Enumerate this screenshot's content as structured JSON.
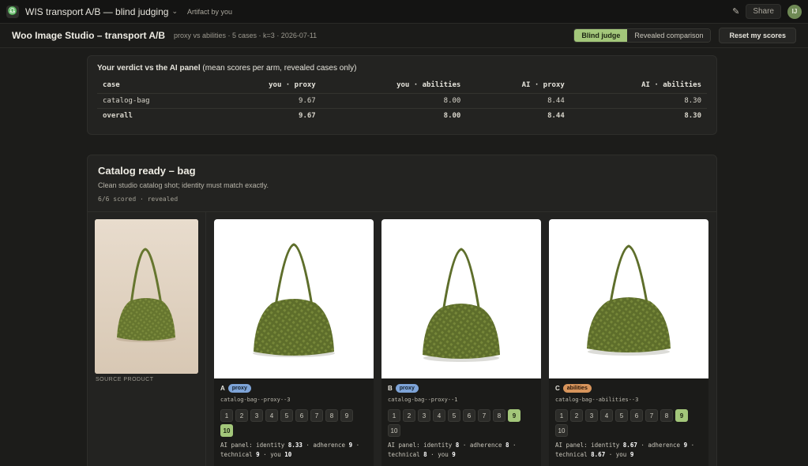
{
  "topbar": {
    "title": "WIS transport A/B — blind judging",
    "artifact": "Artifact by you",
    "share": "Share",
    "avatar": "IJ"
  },
  "header": {
    "title": "Woo Image Studio – transport A/B",
    "meta": "proxy vs abilities · 5 cases · k=3 · 2026-07-11",
    "modes": [
      "Blind judge",
      "Revealed comparison"
    ],
    "active_mode": "Blind judge",
    "reset": "Reset my scores"
  },
  "verdict": {
    "title_bold": "Your verdict vs the AI panel",
    "title_rest": " (mean scores per arm, revealed cases only)",
    "columns": [
      "case",
      "you · proxy",
      "you · abilities",
      "AI · proxy",
      "AI · abilities"
    ],
    "rows": [
      [
        "catalog-bag",
        "9.67",
        "8.00",
        "8.44",
        "8.30"
      ],
      [
        "overall",
        "9.67",
        "8.00",
        "8.44",
        "8.30"
      ]
    ]
  },
  "case": {
    "title": "Catalog ready – bag",
    "desc": "Clean studio catalog shot; identity must match exactly.",
    "status": "6/6 scored · revealed",
    "source_caption": "SOURCE PRODUCT",
    "candidates": [
      {
        "letter": "A",
        "arm": "proxy",
        "slug": "catalog-bag--proxy--3",
        "selected": 10,
        "panel": [
          "AI panel: identity ",
          "8.33",
          " · adherence ",
          "9",
          " · technical ",
          "9",
          " · you ",
          "10"
        ]
      },
      {
        "letter": "B",
        "arm": "proxy",
        "slug": "catalog-bag--proxy--1",
        "selected": 9,
        "panel": [
          "AI panel: identity ",
          "8",
          " · adherence ",
          "8",
          " · technical ",
          "8",
          " · you ",
          "9"
        ]
      },
      {
        "letter": "C",
        "arm": "abilities",
        "slug": "catalog-bag--abilities--3",
        "selected": 9,
        "panel": [
          "AI panel: identity ",
          "8.67",
          " · adherence ",
          "9",
          " · technical ",
          "8.67",
          " · you ",
          "9"
        ]
      }
    ],
    "score_options": [
      "1",
      "2",
      "3",
      "4",
      "5",
      "6",
      "7",
      "8",
      "9",
      "10"
    ]
  },
  "colors": {
    "accent": "#a3c77a",
    "proxy_tag": "#7ea4d8",
    "abilities_tag": "#d8955c",
    "bag": "#6b7a35"
  },
  "icons": [
    "app-icon",
    "chevron-down-icon",
    "pencil-icon"
  ]
}
